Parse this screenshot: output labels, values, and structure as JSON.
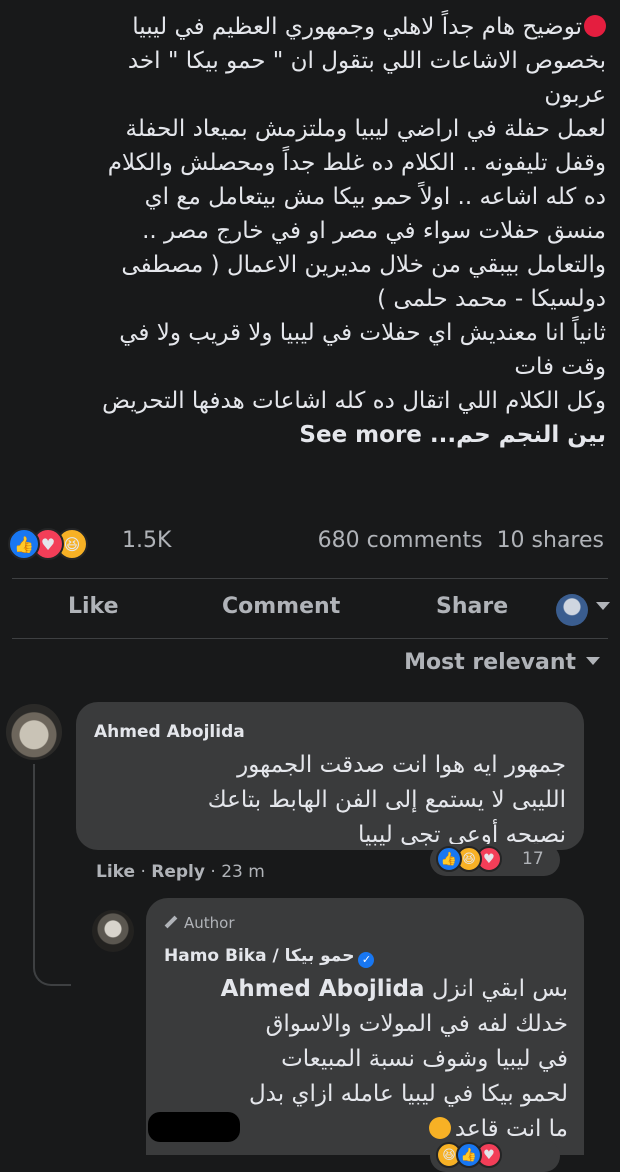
{
  "post": {
    "lines": [
      "توضيح هام جداً لاهلي وجمهوري العظيم في ليبيا",
      "بخصوص الاشاعات اللي بتقول ان \" حمو بيكا \" اخد",
      "عربون",
      "لعمل حفلة في اراضي ليبيا وملتزمش بميعاد الحفلة",
      "وقفل تليفونه .. الكلام ده غلط جداً ومحصلش والكلام",
      "ده كله اشاعه .. اولاً حمو بيكا مش بيتعامل مع اي",
      "منسق حفلات سواء في مصر او في خارج مصر ..",
      "والتعامل بيبقي من خلال مديرين الاعمال ( مصطفى",
      "دولسيكا - محمد حلمى )",
      "ثانياً انا معنديش اي حفلات في ليبيا ولا قريب ولا في",
      "وقت فات",
      "وكل الكلام اللي اتقال ده كله اشاعات هدفها التحريض"
    ],
    "last_line": "بين النجم حم...",
    "see_more": "See more"
  },
  "stats": {
    "reaction_count": "1.5K",
    "comments": "680 comments",
    "shares": "10 shares"
  },
  "actions": {
    "like": "Like",
    "comment": "Comment",
    "share": "Share"
  },
  "sort_label": "Most relevant",
  "comment1": {
    "author": "Ahmed Abojlida",
    "lines": [
      "جمهور ايه هوا انت صدقت الجمهور",
      "الليبى لا يستمع إلى الفن الهابط بتاعك",
      "نصيحه أوعى تجى ليبيا"
    ],
    "reaction_count": "17",
    "like": "Like",
    "reply": "Reply",
    "time": "23 m"
  },
  "reply1": {
    "badge": "Author",
    "author": "Hamo Bika / حمو بيكا",
    "mention": "Ahmed Abojlida",
    "first_line_rest": "بس ابقي انزل",
    "lines": [
      "خدلك لفه في المولات والاسواق",
      "في ليبيا وشوف نسبة المبيعات",
      "لحمو بيكا في ليبيا عامله ازاي بدل"
    ],
    "last_line": "ما انت قاعد"
  },
  "colors": {
    "background": "#18191a",
    "bubble": "#3a3b3c",
    "text": "#e4e6eb",
    "secondary": "#b0b3b8",
    "like_blue": "#1877f2",
    "love_red": "#f33e58",
    "haha_yellow": "#f7b125"
  }
}
